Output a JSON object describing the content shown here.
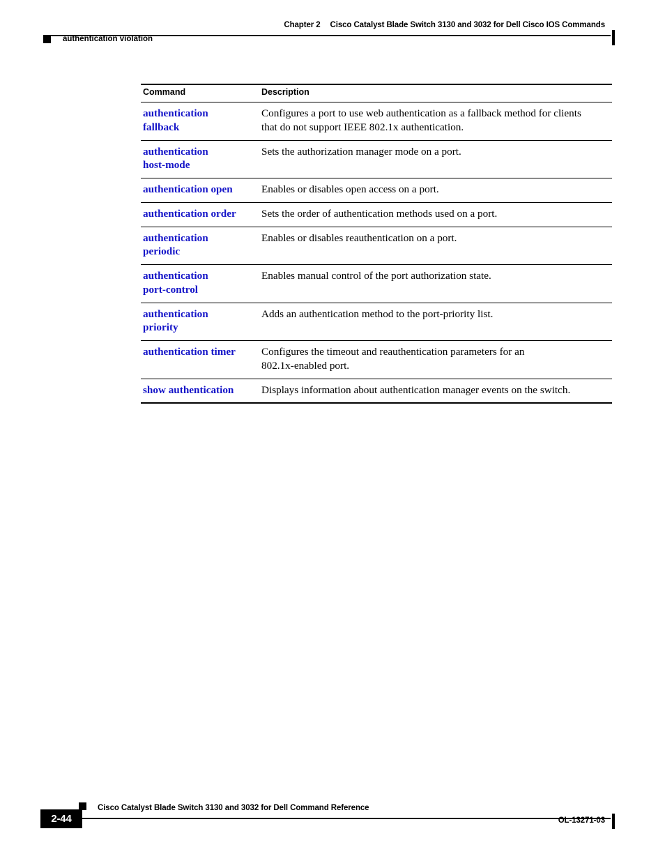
{
  "header": {
    "bullet_icon": "black-square-bullet",
    "left_title": "authentication violation",
    "chapter_label": "Chapter 2",
    "chapter_title": "Cisco Catalyst Blade Switch 3130 and 3032 for Dell Cisco IOS Commands"
  },
  "table": {
    "columns": {
      "command": "Command",
      "description": "Description"
    },
    "rows": [
      {
        "command_lines": [
          "authentication",
          "fallback"
        ],
        "description_lines": [
          "Configures a port to use web authentication as a fallback method for clients",
          "that do not support IEEE 802.1x authentication."
        ]
      },
      {
        "command_lines": [
          "authentication",
          "host-mode"
        ],
        "description_lines": [
          "Sets the authorization manager mode on a port."
        ]
      },
      {
        "command_lines": [
          "authentication open"
        ],
        "description_lines": [
          "Enables or disables open access on a port."
        ]
      },
      {
        "command_lines": [
          "authentication order"
        ],
        "description_lines": [
          "Sets the order of authentication methods used on a port."
        ]
      },
      {
        "command_lines": [
          "authentication",
          "periodic"
        ],
        "description_lines": [
          "Enables or disables reauthentication on a port."
        ]
      },
      {
        "command_lines": [
          "authentication",
          "port-control"
        ],
        "description_lines": [
          "Enables manual control of the port authorization state."
        ]
      },
      {
        "command_lines": [
          "authentication",
          "priority"
        ],
        "description_lines": [
          "Adds an authentication method to the port-priority list."
        ]
      },
      {
        "command_lines": [
          "authentication timer"
        ],
        "description_lines": [
          "Configures the timeout and reauthentication parameters for an",
          "802.1x-enabled port."
        ]
      },
      {
        "command_lines": [
          "show authentication"
        ],
        "description_lines": [
          "Displays information about authentication manager events on the switch."
        ]
      }
    ]
  },
  "footer": {
    "marker_icon": "black-square-marker",
    "book_title": "Cisco Catalyst Blade Switch 3130 and 3032 for Dell Command Reference",
    "page_number": "2-44",
    "doc_id": "OL-13271-03"
  },
  "colors": {
    "link_blue": "#1414C8",
    "rule_black": "#000000",
    "page_background": "#ffffff"
  }
}
